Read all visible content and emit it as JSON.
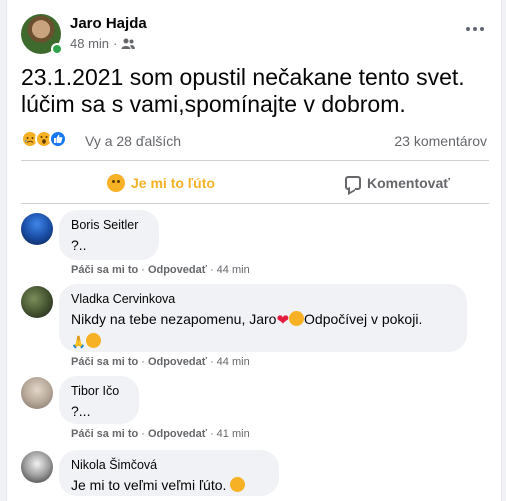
{
  "post": {
    "author": "Jaro Hajda",
    "time": "48 min",
    "audience_icon": "friends-icon",
    "text_line1": "23.1.2021 som opustil nečakane tento svet.",
    "text_line2": "lúčim sa s vami,spomínajte v dobrom."
  },
  "reactions": {
    "icons": [
      "sad-reaction",
      "wow-reaction",
      "like-reaction"
    ],
    "summary": "Vy a 28 ďalších",
    "comment_count": "23 komentárov"
  },
  "actions": {
    "react_label": "Je mi to ľúto",
    "comment_label": "Komentovať"
  },
  "comment_meta": {
    "like": "Páči sa mi to",
    "sep": "·",
    "reply": "Odpovedať"
  },
  "comments": [
    {
      "name": "Boris Seitler",
      "text": "?..",
      "time": "44 min"
    },
    {
      "name": "Vladka Cervinkova",
      "text_a": "Nikdy na tebe nezapomenu, Jaro",
      "text_b": "Odpočívej v pokoji.",
      "time": "44 min"
    },
    {
      "name": "Tibor Ičo",
      "text": "?...",
      "time": "41 min"
    },
    {
      "name": "Nikola Šimčová",
      "text": "Je mi to veľmi veľmi ľúto."
    }
  ],
  "colors": {
    "accent_blue": "#1877f2",
    "sad_yellow": "#f7b125",
    "muted": "#65676b",
    "bubble": "#f0f2f5"
  }
}
